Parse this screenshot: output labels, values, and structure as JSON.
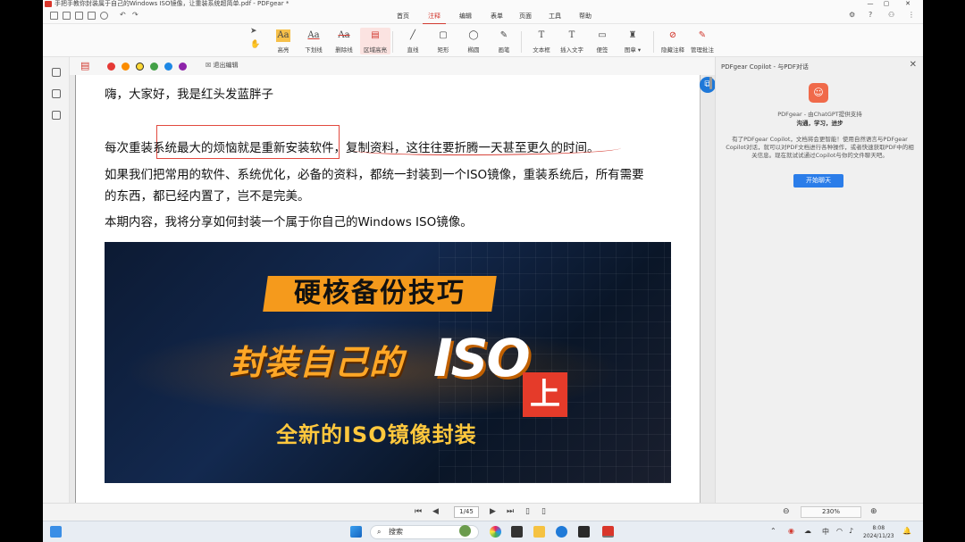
{
  "window": {
    "title": "手把手教你封装属于自己的Windows ISO镜像，让重装系统超简单.pdf - PDFgear *",
    "minimize": "—",
    "maximize": "▢",
    "close": "✕"
  },
  "tabs": [
    {
      "label": "首页"
    },
    {
      "label": "注释",
      "active": true
    },
    {
      "label": "编辑"
    },
    {
      "label": "表单"
    },
    {
      "label": "页面"
    },
    {
      "label": "工具"
    },
    {
      "label": "帮助"
    }
  ],
  "toolbar": {
    "tools": [
      {
        "label": "高亮",
        "icon": "highlight-icon",
        "glyph": "Aa"
      },
      {
        "label": "下划线",
        "icon": "underline-icon",
        "glyph": "Aa"
      },
      {
        "label": "删除线",
        "icon": "strikethrough-icon",
        "glyph": "Aa"
      },
      {
        "label": "区域高亮",
        "icon": "area-highlight-icon",
        "glyph": "▤"
      },
      {
        "label": "直线",
        "icon": "line-icon",
        "glyph": "╱"
      },
      {
        "label": "矩形",
        "icon": "rectangle-icon",
        "glyph": "▢"
      },
      {
        "label": "椭圆",
        "icon": "ellipse-icon",
        "glyph": "◯"
      },
      {
        "label": "画笔",
        "icon": "pen-icon",
        "glyph": "✎"
      },
      {
        "label": "文本框",
        "icon": "textbox-icon",
        "glyph": "T"
      },
      {
        "label": "插入文字",
        "icon": "insert-text-icon",
        "glyph": "T"
      },
      {
        "label": "便签",
        "icon": "note-icon",
        "glyph": "▭"
      },
      {
        "label": "图章 ▾",
        "icon": "stamp-icon",
        "glyph": "♜"
      },
      {
        "label": "隐藏注释",
        "icon": "hide-annotations-icon",
        "glyph": "⊘"
      },
      {
        "label": "管理批注",
        "icon": "manage-annotations-icon",
        "glyph": "✎"
      }
    ]
  },
  "subbar": {
    "colors": [
      "#e53935",
      "#fb8c00",
      "#fdd835",
      "#43a047",
      "#1e88e5",
      "#8e24aa"
    ],
    "exit_label": "退出编辑"
  },
  "document": {
    "line1": "嗨，大家好，我是红头发蓝胖子",
    "line2": "每次重装系统最大的烦恼就是重新安装软件，复制资料，这往往要折腾一天甚至更久的时间。",
    "line3": "如果我们把常用的软件、系统优化，必备的资料，都统一封装到一个ISO镜像，重装系统后，所有需要",
    "line4": "的东西，都已经内置了，岂不是完美。",
    "line5": "本期内容，我将分享如何封装一个属于你自己的Windows ISO镜像。",
    "banner": {
      "title": "硬核备份技巧",
      "headline": "封装自己的",
      "iso": "ISO",
      "part": "上",
      "subtitle": "全新的ISO镜像封装"
    }
  },
  "copilot": {
    "header": "PDFgear Copilot - 与PDF对话",
    "powered": "PDFgear - 由ChatGPT提供支持",
    "slogan": "沟通，学习，进步",
    "description": "有了PDFgear Copilot，文档将会更智能！使用自然语言与PDFgear Copilot对话，就可以对PDF文档进行各种操作，或者快速获取PDF中的相关信息。现在就试试通过Copilot与你的文件聊天吧。",
    "button": "开始聊天"
  },
  "navbar": {
    "page_indicator": "1/45",
    "zoom": "230%"
  },
  "taskbar": {
    "search_placeholder": "搜索",
    "ime": "中",
    "time": "8:08",
    "date": "2024/11/23"
  }
}
